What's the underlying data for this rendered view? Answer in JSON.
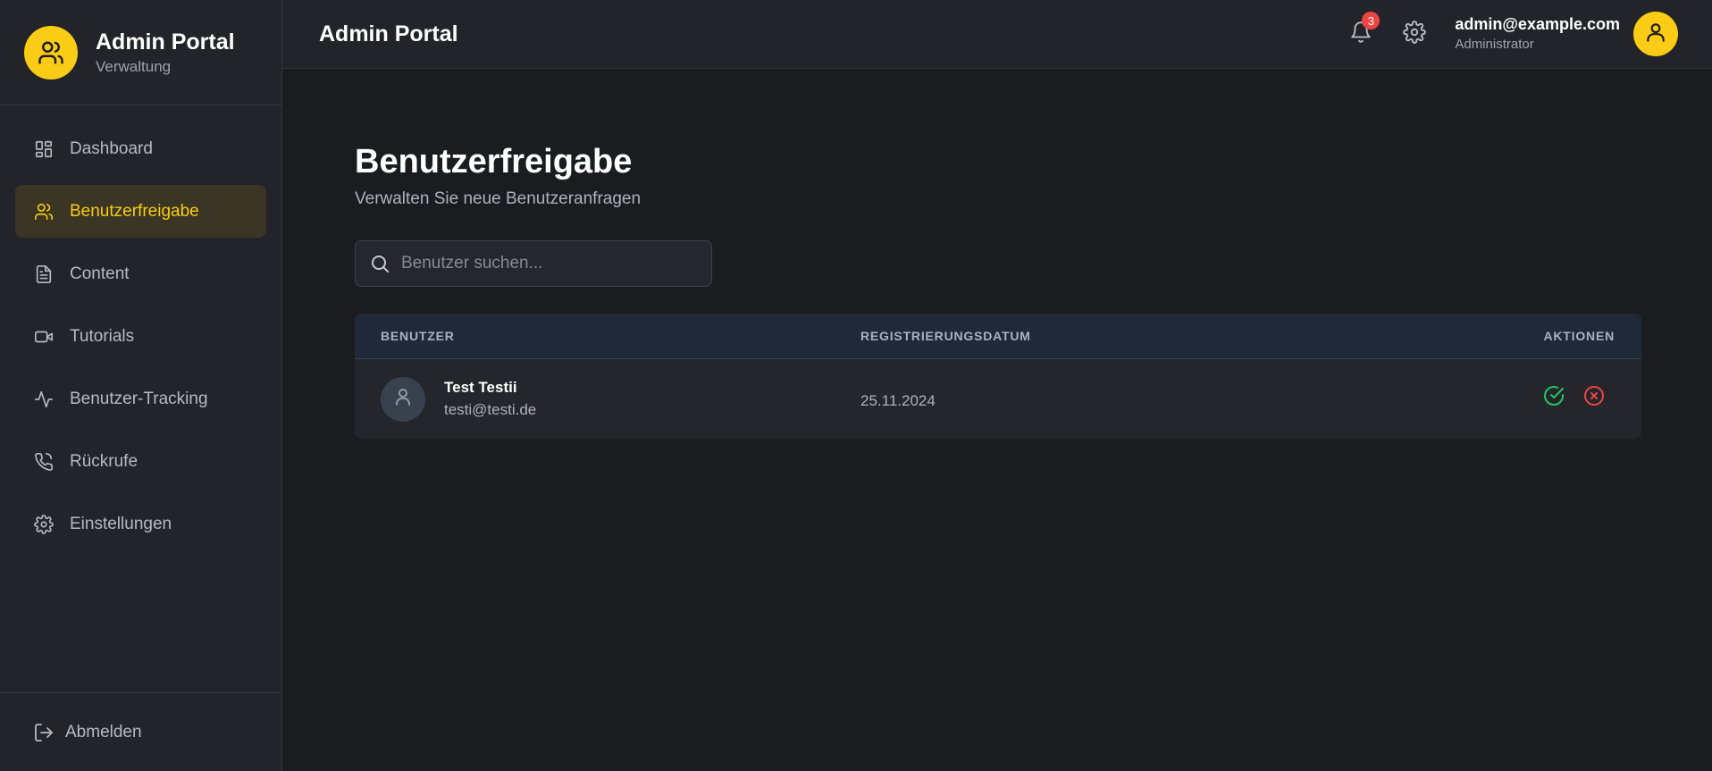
{
  "sidebar": {
    "brand_title": "Admin Portal",
    "brand_subtitle": "Verwaltung",
    "items": [
      {
        "label": "Dashboard",
        "icon": "dashboard-icon"
      },
      {
        "label": "Benutzerfreigabe",
        "icon": "users-icon",
        "active": true
      },
      {
        "label": "Content",
        "icon": "document-icon"
      },
      {
        "label": "Tutorials",
        "icon": "video-icon"
      },
      {
        "label": "Benutzer-Tracking",
        "icon": "activity-icon"
      },
      {
        "label": "Rückrufe",
        "icon": "phone-icon"
      },
      {
        "label": "Einstellungen",
        "icon": "gear-icon"
      }
    ],
    "logout_label": "Abmelden"
  },
  "header": {
    "title": "Admin Portal",
    "notification_count": "3",
    "user_email": "admin@example.com",
    "user_role": "Administrator"
  },
  "main": {
    "title": "Benutzerfreigabe",
    "subtitle": "Verwalten Sie neue Benutzeranfragen",
    "search_placeholder": "Benutzer suchen...",
    "table": {
      "columns": [
        "BENUTZER",
        "REGISTRIERUNGSDATUM",
        "AKTIONEN"
      ],
      "rows": [
        {
          "name": "Test Testii",
          "email": "testi@testi.de",
          "date": "25.11.2024"
        }
      ]
    }
  },
  "colors": {
    "accent": "#facc15",
    "approve": "#22c55e",
    "reject": "#ef4444"
  }
}
